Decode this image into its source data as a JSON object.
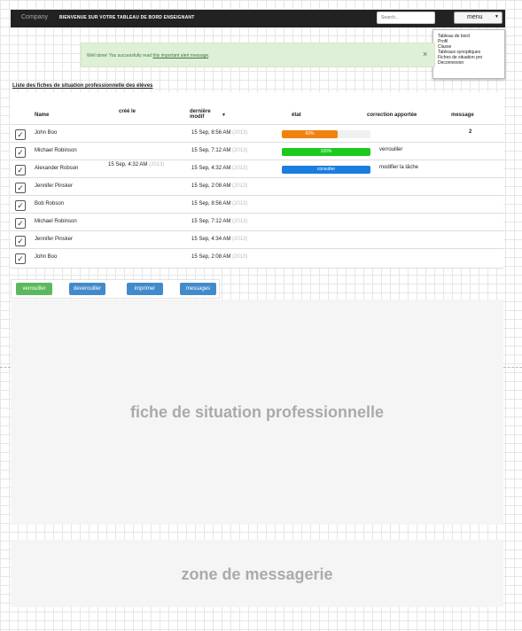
{
  "navbar": {
    "brand": "Company",
    "welcome": "BIENVENUE SUR VOTRE TABLEAU DE BORD ENSEIGNANT",
    "search_placeholder": "Search...",
    "menu_label": "menu",
    "menu_items": [
      "Tableau de bord",
      "Profil",
      "Classe",
      "Tableaux synoptiques",
      "Fiches de situation pro",
      "Deconnexion"
    ]
  },
  "alert": {
    "text": "Well done! You successfully read ",
    "link": "this important alert message",
    "end": ".",
    "close": "×"
  },
  "list": {
    "title": "Liste des fiches de situation professionnelle des élèves",
    "columns": {
      "name": "Name",
      "created": "créé le",
      "modified": "dernière modif",
      "sort": "▼",
      "state": "état",
      "correction": "correction apportée",
      "message": "message"
    },
    "rows": [
      {
        "name": "John Boo",
        "created": "",
        "created_year": "",
        "modified": "15 Sep, 8:56 AM",
        "modified_year": "(2013)",
        "state": {
          "label": "60%",
          "fill": 0.63,
          "color": "#f0820f"
        },
        "correction": "",
        "message": "2"
      },
      {
        "name": "Michael Robinson",
        "created": "",
        "created_year": "",
        "modified": "15 Sep, 7:12 AM",
        "modified_year": "(2013)",
        "state": {
          "label": "100%",
          "fill": 1.0,
          "color": "#1ec91e"
        },
        "correction": "verrouiller",
        "message": ""
      },
      {
        "name": "Alexander Robson",
        "created": "15 Sep, 4:32 AM",
        "created_year": "(2013)",
        "modified": "15 Sep, 4:32 AM",
        "modified_year": "(2013)",
        "state": {
          "label": "consulter",
          "fill": 1.0,
          "color": "#1a7de0"
        },
        "correction": "modifier la tâche",
        "message": ""
      },
      {
        "name": "Jennifer Pinsker",
        "created": "",
        "created_year": "",
        "modified": "15 Sep, 2:08 AM",
        "modified_year": "(2013)",
        "state": null,
        "correction": "",
        "message": ""
      },
      {
        "name": "Bob Robson",
        "created": "",
        "created_year": "",
        "modified": "15 Sep, 8:56 AM",
        "modified_year": "(2013)",
        "state": null,
        "correction": "",
        "message": ""
      },
      {
        "name": "Michael Robinson",
        "created": "",
        "created_year": "",
        "modified": "15 Sep, 7:12 AM",
        "modified_year": "(2013)",
        "state": null,
        "correction": "",
        "message": ""
      },
      {
        "name": "Jennifer Pinsker",
        "created": "",
        "created_year": "",
        "modified": "15 Sep, 4:34 AM",
        "modified_year": "(2013)",
        "state": null,
        "correction": "",
        "message": ""
      },
      {
        "name": "John Boo",
        "created": "",
        "created_year": "",
        "modified": "15 Sep, 2:08 AM",
        "modified_year": "(2013)",
        "state": null,
        "correction": "",
        "message": ""
      }
    ]
  },
  "actions": {
    "verrouiller": "verrouiller",
    "deverouiller": "deverouiller",
    "imprimer": "imprimer",
    "messages": "messages",
    "colors": {
      "green": "#5cb85c",
      "blue": "#428bca"
    }
  },
  "panels": {
    "fiche": "fiche de situation professionnelle",
    "messagerie": "zone de messagerie"
  }
}
